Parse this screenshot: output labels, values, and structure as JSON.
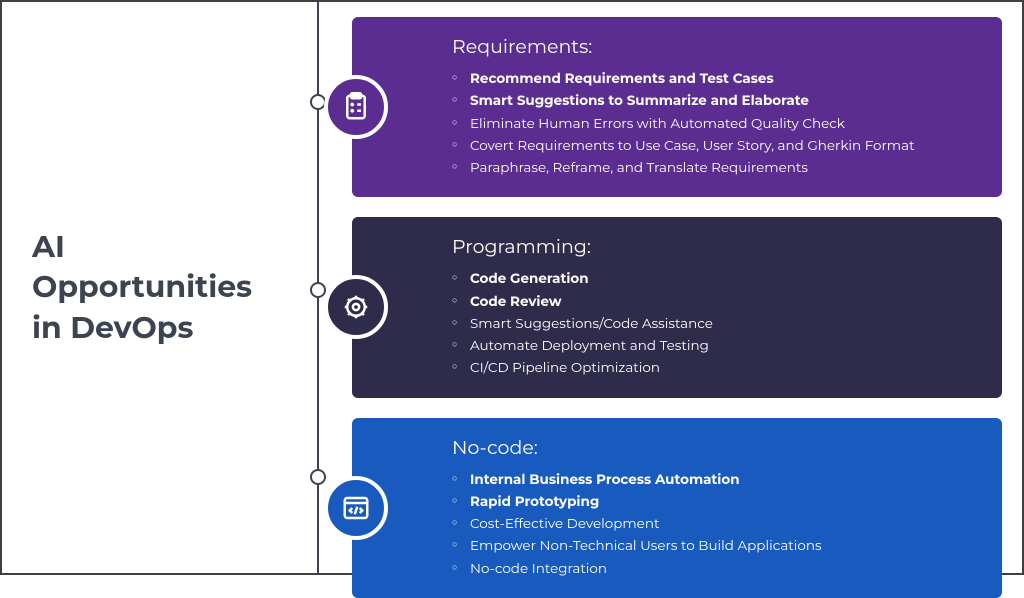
{
  "title": "AI Opportunities in DevOps",
  "cards": [
    {
      "heading": "Requirements:",
      "items": [
        {
          "text": "Recommend Requirements and Test Cases",
          "bold": true
        },
        {
          "text": "Smart Suggestions to Summarize and Elaborate",
          "bold": true
        },
        {
          "text": "Eliminate Human Errors with Automated Quality Check",
          "bold": false
        },
        {
          "text": "Covert Requirements to Use Case, User Story, and Gherkin Format",
          "bold": false
        },
        {
          "text": "Paraphrase, Reframe, and Translate Requirements",
          "bold": false
        }
      ]
    },
    {
      "heading": "Programming:",
      "items": [
        {
          "text": "Code Generation",
          "bold": true
        },
        {
          "text": "Code Review",
          "bold": true
        },
        {
          "text": "Smart Suggestions/Code Assistance",
          "bold": false
        },
        {
          "text": "Automate Deployment and Testing",
          "bold": false
        },
        {
          "text": "CI/CD Pipeline Optimization",
          "bold": false
        }
      ]
    },
    {
      "heading": "No-code:",
      "items": [
        {
          "text": "Internal Business Process Automation",
          "bold": true
        },
        {
          "text": "Rapid Prototyping",
          "bold": true
        },
        {
          "text": "Cost-Effective Development",
          "bold": false
        },
        {
          "text": "Empower Non-Technical Users to Build Applications",
          "bold": false
        },
        {
          "text": "No-code Integration",
          "bold": false
        }
      ]
    }
  ]
}
